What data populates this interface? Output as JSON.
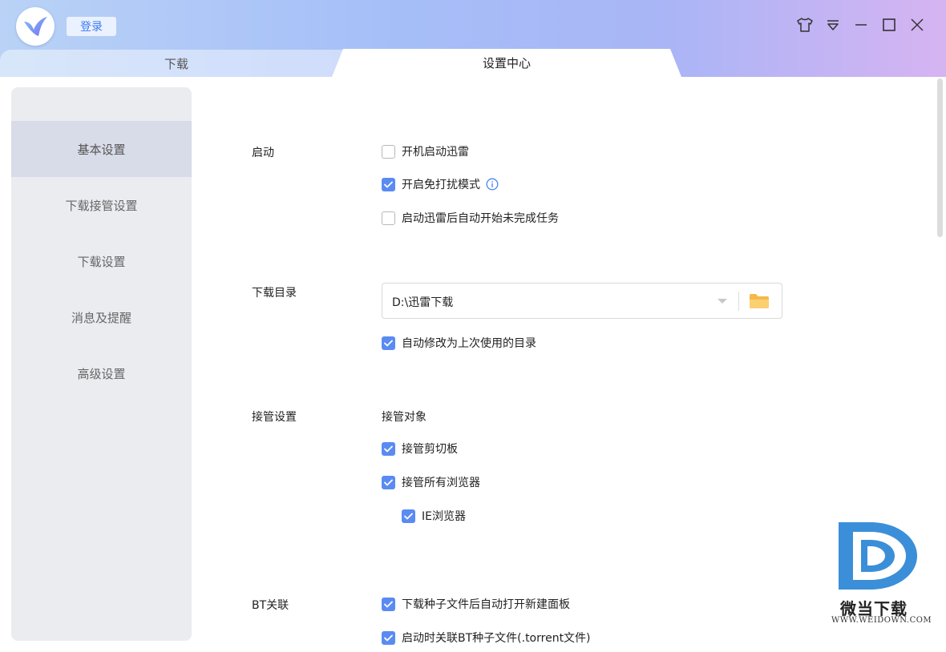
{
  "header": {
    "login_label": "登录",
    "tabs": {
      "download": "下载",
      "settings": "设置中心"
    },
    "window_controls": [
      "shirt-icon",
      "dropdown-menu-icon",
      "minimize-icon",
      "maximize-icon",
      "close-icon"
    ]
  },
  "sidebar": {
    "items": [
      {
        "label": "基本设置",
        "active": true
      },
      {
        "label": "下载接管设置",
        "active": false
      },
      {
        "label": "下载设置",
        "active": false
      },
      {
        "label": "消息及提醒",
        "active": false
      },
      {
        "label": "高级设置",
        "active": false
      }
    ]
  },
  "sections": {
    "startup": {
      "label": "启动",
      "options": [
        {
          "label": "开机启动迅雷",
          "checked": false
        },
        {
          "label": "开启免打扰模式",
          "checked": true
        },
        {
          "label": "启动迅雷后自动开始未完成任务",
          "checked": false
        }
      ]
    },
    "download_dir": {
      "label": "下载目录",
      "value": "D:\\迅雷下载",
      "options": [
        {
          "label": "自动修改为上次使用的目录",
          "checked": true
        }
      ]
    },
    "takeover": {
      "label": "接管设置",
      "sub_heading": "接管对象",
      "options": [
        {
          "label": "接管剪切板",
          "checked": true
        },
        {
          "label": "接管所有浏览器",
          "checked": true
        },
        {
          "label": "IE浏览器",
          "checked": true
        }
      ]
    },
    "bt": {
      "label": "BT关联",
      "options": [
        {
          "label": "下载种子文件后自动打开新建面板",
          "checked": true
        },
        {
          "label": "启动时关联BT种子文件(.torrent文件)",
          "checked": true
        }
      ]
    }
  },
  "watermark": {
    "title": "微当下载",
    "url": "WWW.WEIDOWN.COM"
  },
  "colors": {
    "accent": "#5a8bf2",
    "checkbox_border": "#b8b8b8",
    "folder": "#f5b94a"
  }
}
